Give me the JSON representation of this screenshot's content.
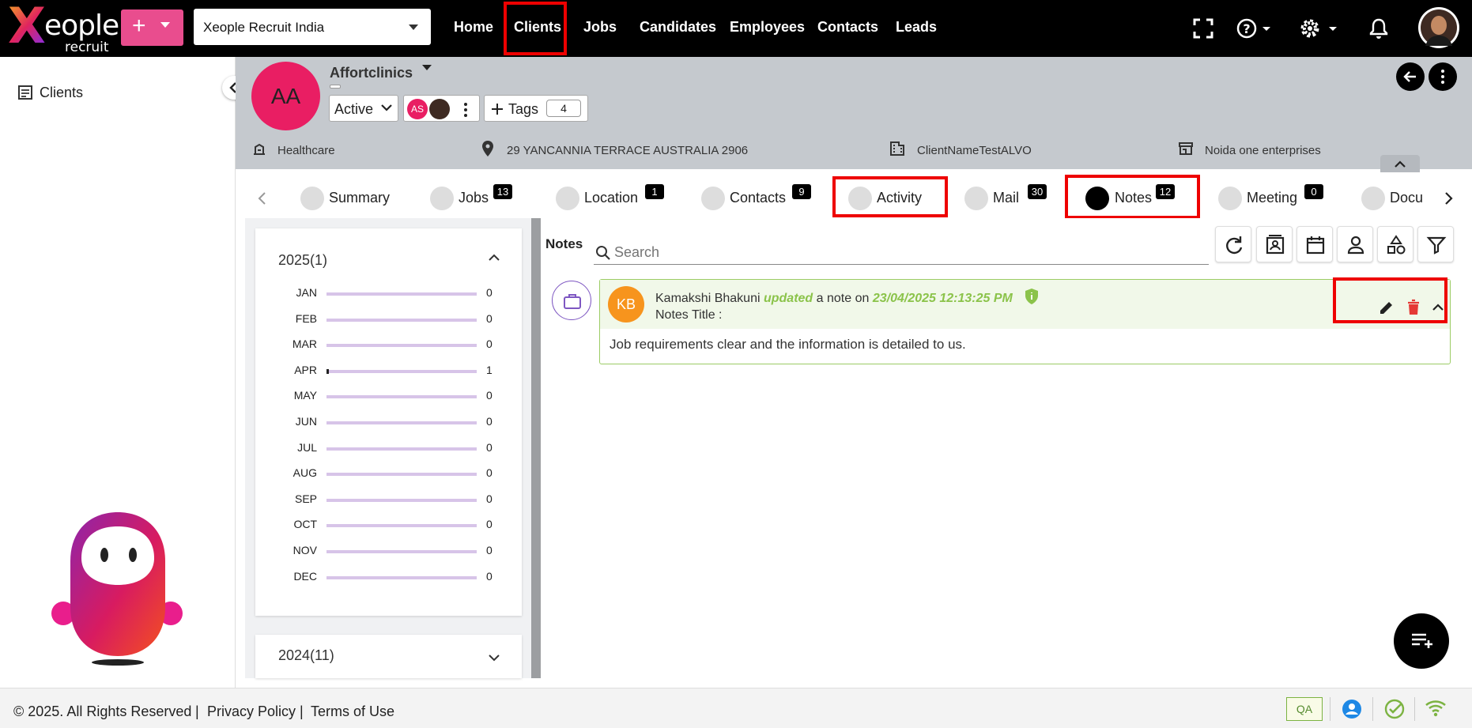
{
  "topbar": {
    "logo_word": "eople",
    "logo_sub": "recruit",
    "org_select_value": "Xeople Recruit India",
    "nav": [
      "Home",
      "Clients",
      "Jobs",
      "Candidates",
      "Employees",
      "Contacts",
      "Leads"
    ],
    "active_nav": "Clients"
  },
  "sidebar": {
    "items": [
      {
        "label": "Clients",
        "icon": "list-icon"
      }
    ]
  },
  "client": {
    "initials": "AA",
    "name": "Affortclinics",
    "status": "Active",
    "owner_initials": "AS",
    "tags_label": "Tags",
    "tags_count": "4",
    "industry": "Healthcare",
    "address": "29 YANCANNIA TERRACE AUSTRALIA 2906",
    "company": "ClientNameTestALVO",
    "parent": "Noida one enterprises"
  },
  "tabs": [
    {
      "label": "Summary",
      "badge": ""
    },
    {
      "label": "Jobs",
      "badge": "13"
    },
    {
      "label": "Location",
      "badge": "1"
    },
    {
      "label": "Contacts",
      "badge": "9"
    },
    {
      "label": "Activity",
      "badge": ""
    },
    {
      "label": "Mail",
      "badge": "30"
    },
    {
      "label": "Notes",
      "badge": "12"
    },
    {
      "label": "Meeting",
      "badge": "0"
    },
    {
      "label": "Docu",
      "badge": ""
    }
  ],
  "timeline": {
    "year_2025": "2025(1)",
    "year_2024": "2024(11)",
    "months": [
      {
        "m": "JAN",
        "v": 0
      },
      {
        "m": "FEB",
        "v": 0
      },
      {
        "m": "MAR",
        "v": 0
      },
      {
        "m": "APR",
        "v": 1
      },
      {
        "m": "MAY",
        "v": 0
      },
      {
        "m": "JUN",
        "v": 0
      },
      {
        "m": "JUL",
        "v": 0
      },
      {
        "m": "AUG",
        "v": 0
      },
      {
        "m": "SEP",
        "v": 0
      },
      {
        "m": "OCT",
        "v": 0
      },
      {
        "m": "NOV",
        "v": 0
      },
      {
        "m": "DEC",
        "v": 0
      }
    ]
  },
  "notes": {
    "label": "Notes",
    "search_placeholder": "Search",
    "item": {
      "avatar": "KB",
      "author": "Kamakshi Bhakuni",
      "action": "updated",
      "middle": "a note on",
      "datetime": "23/04/2025 12:13:25 PM",
      "title_label": "Notes Title :",
      "body": "Job requirements clear and the information is detailed to us."
    }
  },
  "footer": {
    "copyright": "© 2025. All Rights Reserved",
    "sep": "|",
    "privacy": "Privacy Policy",
    "terms": "Terms of Use",
    "env": "QA"
  },
  "colors": {
    "accent_pink": "#e94d8e",
    "avatar_pink": "#e91e63",
    "note_green": "#8bc34a",
    "highlight_red": "#ee0000"
  }
}
